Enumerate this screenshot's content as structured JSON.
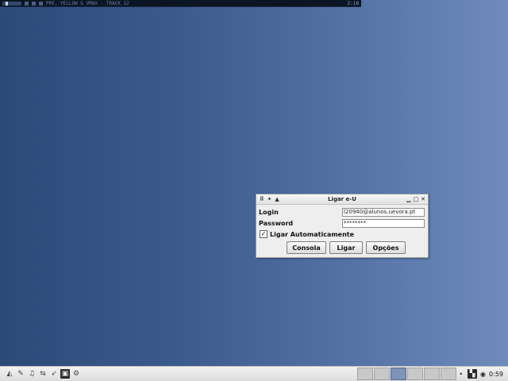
{
  "media_bar": {
    "track_text": "PRE, YELLOW & VMAX - TRACK 12",
    "time": "2:18"
  },
  "dialog": {
    "title": "Ligar e-U",
    "login_label": "Login",
    "login_value": "l20940@alunos.uevora.pt",
    "password_label": "Password",
    "password_value": "********",
    "auto_connect_label": "Ligar Automaticamente",
    "auto_connect_checked": true,
    "buttons": {
      "consola": "Consola",
      "ligar": "Ligar",
      "opcoes": "Opções"
    }
  },
  "taskbar": {
    "launchers": [
      "home-icon",
      "pencil-icon",
      "music-icon",
      "network-icon",
      "terminal-icon",
      "settings-icon"
    ],
    "desktops": 6,
    "active_desktop": 3,
    "clock": "0:59"
  }
}
